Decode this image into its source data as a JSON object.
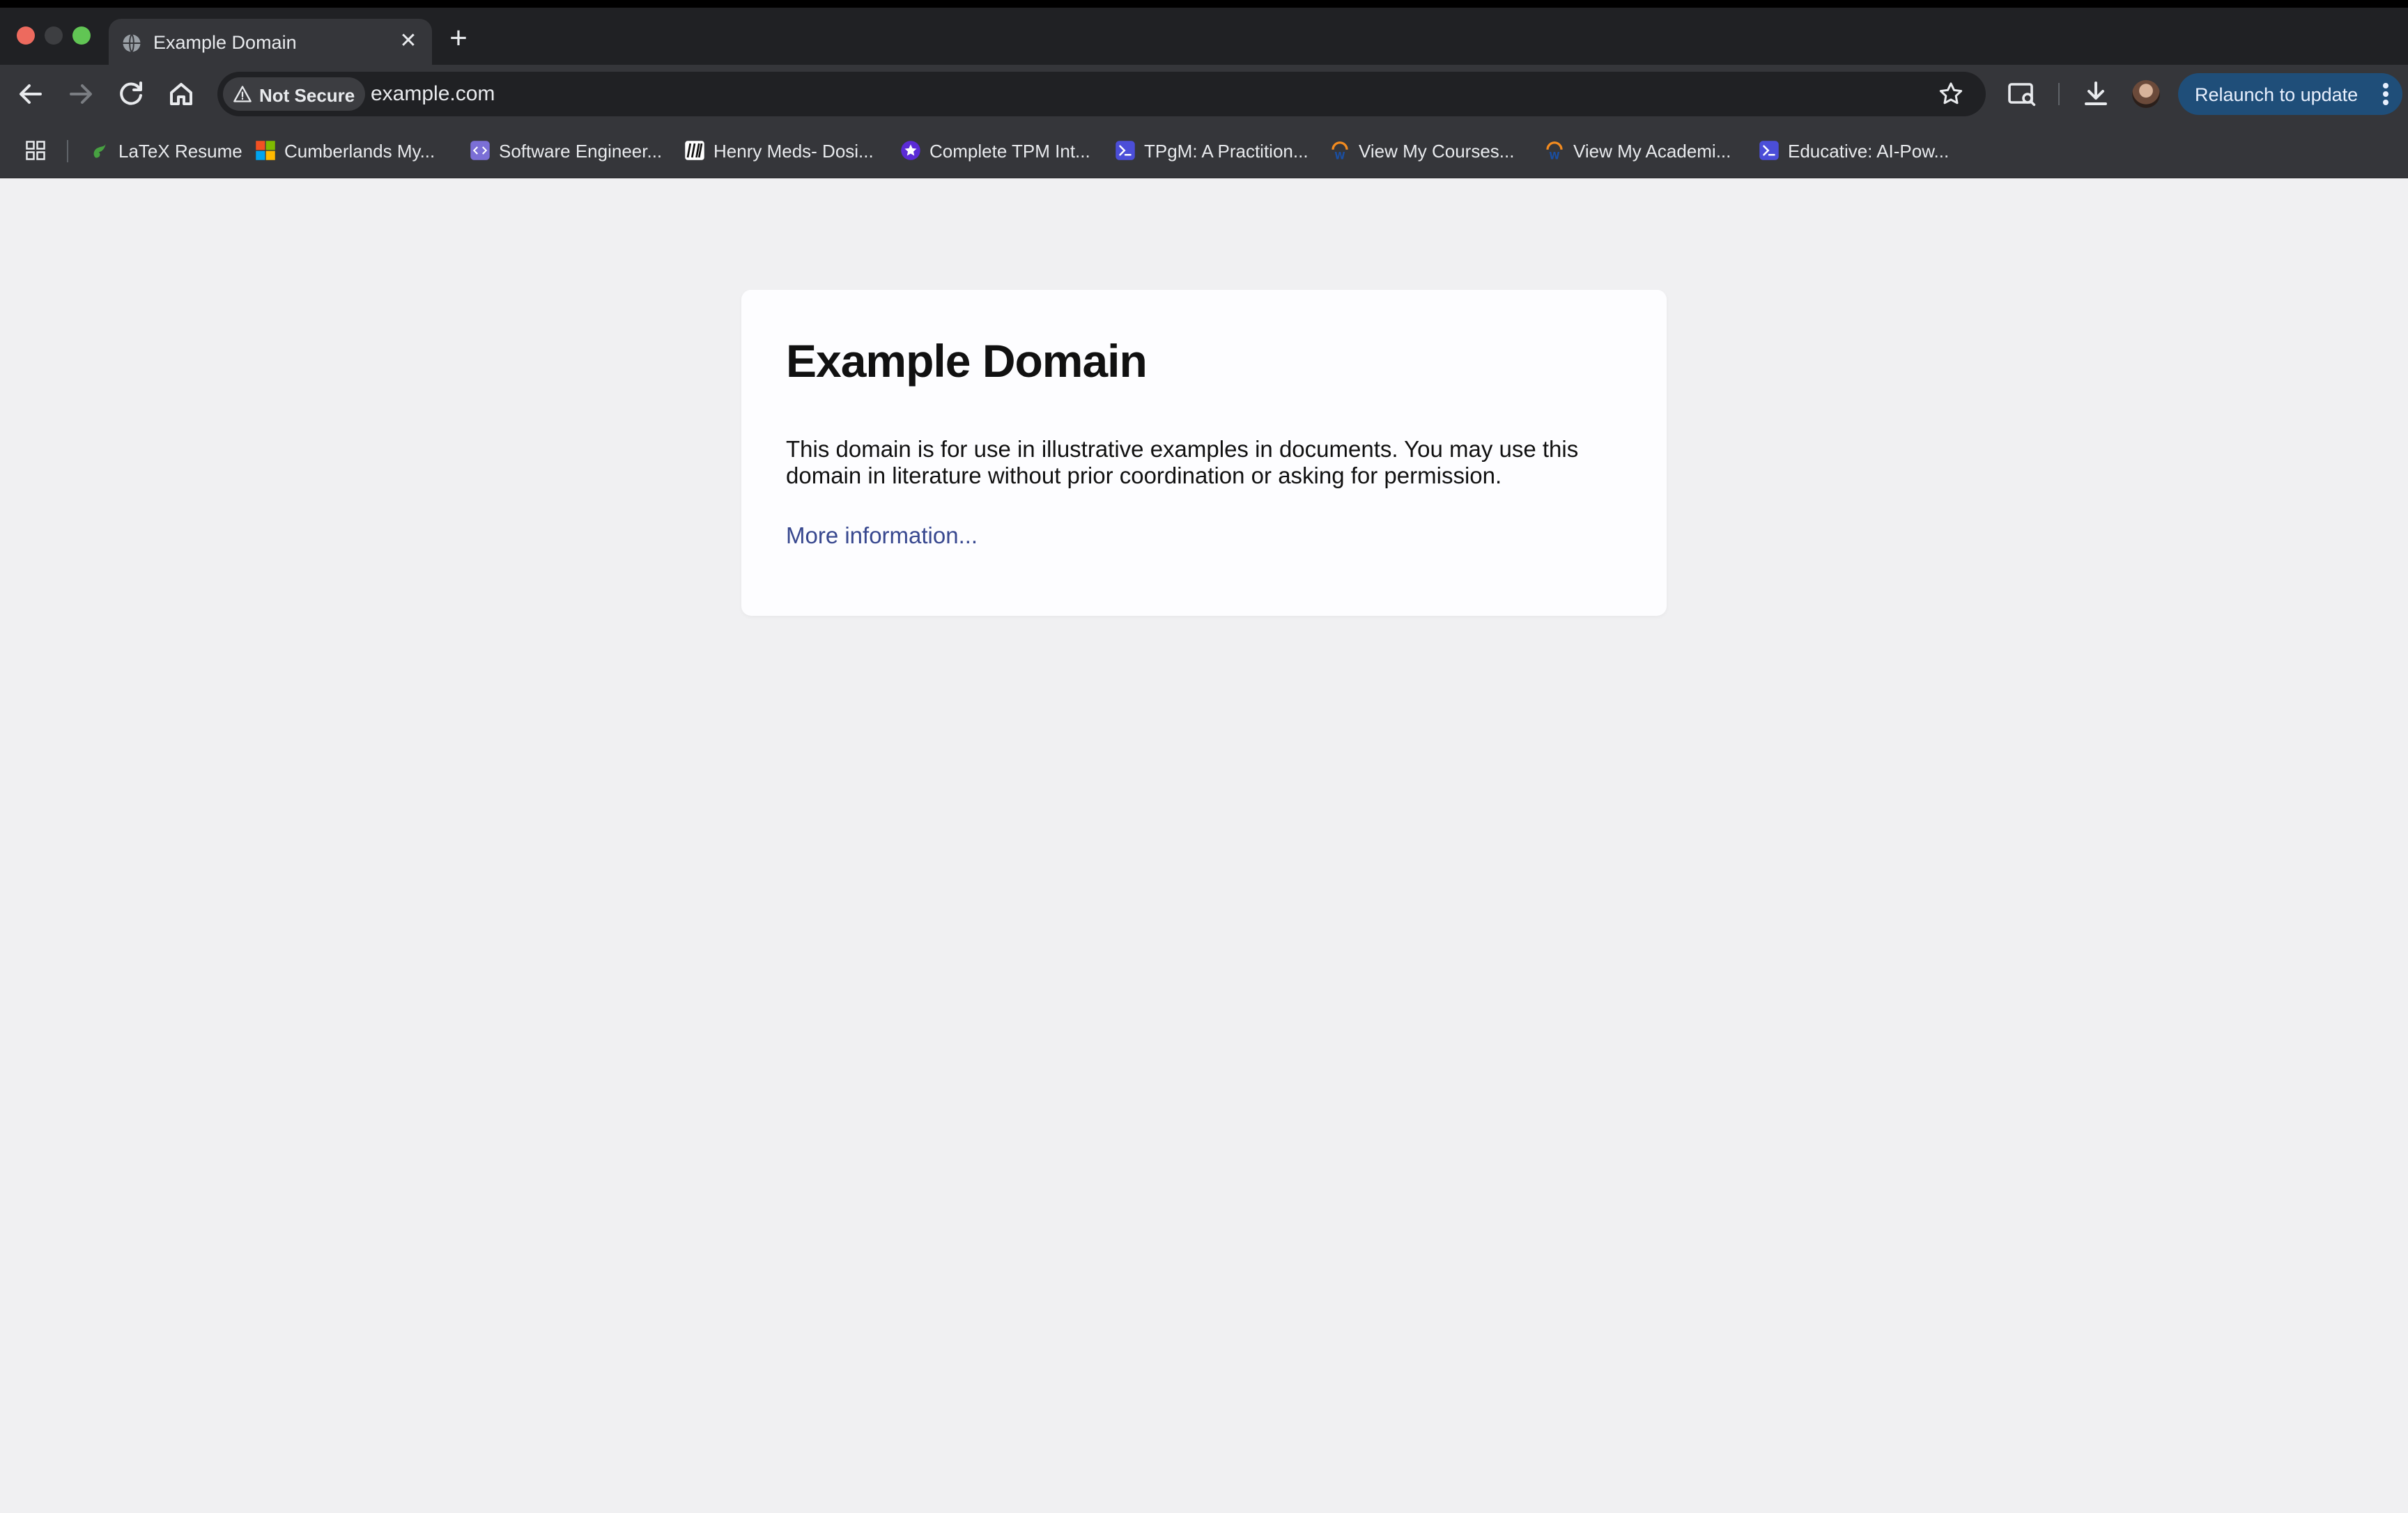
{
  "window": {
    "tab_title": "Example Domain",
    "new_tab_symbol": "+",
    "tab_close_symbol": "✕"
  },
  "toolbar": {
    "security_label": "Not Secure",
    "url": "example.com",
    "relaunch_label": "Relaunch to update"
  },
  "bookmarks": [
    {
      "label": "LaTeX Resume",
      "icon": "overleaf-icon",
      "color": "#47a141"
    },
    {
      "label": "Cumberlands My...",
      "icon": "microsoft-icon",
      "color": "#f25022"
    },
    {
      "label": "Software Engineer...",
      "icon": "code-icon",
      "color": "#7b6fd6"
    },
    {
      "label": "Henry Meds- Dosi...",
      "icon": "henry-meds-icon",
      "color": "#ffffff"
    },
    {
      "label": "Complete TPM Int...",
      "icon": "star-badge-icon",
      "color": "#5b2bd6"
    },
    {
      "label": "TPgM: A Practition...",
      "icon": "educative-icon",
      "color": "#4b4ed8"
    },
    {
      "label": "View My Courses...",
      "icon": "workday-icon",
      "color": "#f38b1f"
    },
    {
      "label": "View My Academi...",
      "icon": "workday-icon",
      "color": "#f38b1f"
    },
    {
      "label": "Educative: AI-Pow...",
      "icon": "educative-icon",
      "color": "#4b4ed8"
    }
  ],
  "page": {
    "heading": "Example Domain",
    "body": "This domain is for use in illustrative examples in documents. You may use this domain in literature without prior coordination or asking for permission.",
    "link": "More information..."
  },
  "colors": {
    "page_background": "#f0f0f2",
    "link": "#38488f",
    "relaunch_button": "#1f4e79"
  }
}
